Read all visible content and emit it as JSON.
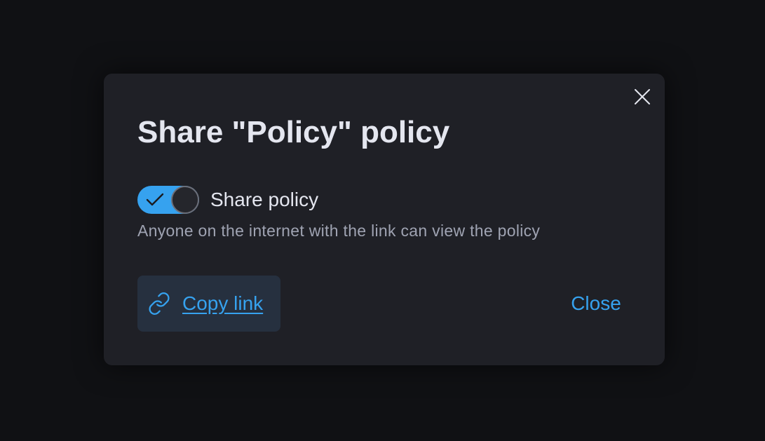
{
  "dialog": {
    "title": "Share \"Policy\" policy",
    "close_icon": "close-icon",
    "toggle": {
      "label": "Share policy",
      "checked": true,
      "on_color": "#36a2ef"
    },
    "helper_text": "Anyone on the internet with the link can view the policy",
    "copy_button": {
      "label": "Copy link",
      "icon": "link-icon"
    },
    "close_button": {
      "label": "Close"
    }
  },
  "colors": {
    "backdrop": "#101114",
    "dialog_bg": "#1f2026",
    "accent": "#36a2ef",
    "text_primary": "#e4e6ef",
    "text_secondary": "#9fa3b2"
  }
}
